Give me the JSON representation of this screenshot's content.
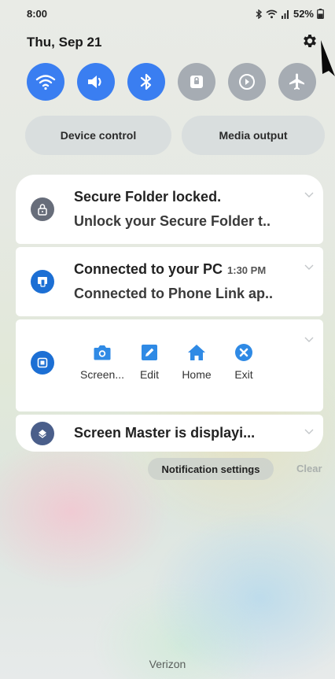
{
  "status_bar": {
    "time": "8:00",
    "battery": "52%",
    "icons": [
      "bluetooth-icon",
      "wifi-icon",
      "signal-icon",
      "battery-icon"
    ]
  },
  "header": {
    "date": "Thu, Sep 21",
    "settings_icon": "gear-icon"
  },
  "quick_toggles": [
    {
      "name": "wifi",
      "icon": "wifi-icon",
      "state": "on"
    },
    {
      "name": "sound",
      "icon": "sound-icon",
      "state": "on"
    },
    {
      "name": "bluetooth",
      "icon": "bluetooth-icon",
      "state": "on"
    },
    {
      "name": "secure-folder",
      "icon": "lock-icon",
      "state": "off"
    },
    {
      "name": "auto-rotate",
      "icon": "rotate-icon",
      "state": "off"
    },
    {
      "name": "airplane-mode",
      "icon": "airplane-icon",
      "state": "off"
    }
  ],
  "controls": {
    "device_control": "Device control",
    "media_output": "Media output"
  },
  "notifications": [
    {
      "app_icon": "lock-icon",
      "title": "Secure Folder locked.",
      "body": "Unlock your Secure Folder t.."
    },
    {
      "app_icon": "phone-link-icon",
      "title": "Connected to your PC",
      "time": "1:30 PM",
      "body": "Connected to Phone Link ap.."
    },
    {
      "app_icon": "screen-master-icon",
      "actions": [
        {
          "label": "Screen...",
          "icon": "camera-icon"
        },
        {
          "label": "Edit",
          "icon": "edit-icon"
        },
        {
          "label": "Home",
          "icon": "home-icon"
        },
        {
          "label": "Exit",
          "icon": "close-icon"
        }
      ]
    },
    {
      "app_icon": "layers-icon",
      "title": "Screen Master is displayi..."
    }
  ],
  "footer": {
    "notification_settings": "Notification settings",
    "clear": "Clear",
    "carrier": "Verizon"
  },
  "colors": {
    "toggle_on": "#3a7ef1",
    "toggle_off": "#a6acb3",
    "phone_link_blue": "#1c6fd4",
    "gray_icon": "#676d7a",
    "tool_blue": "#2f8ae5"
  }
}
